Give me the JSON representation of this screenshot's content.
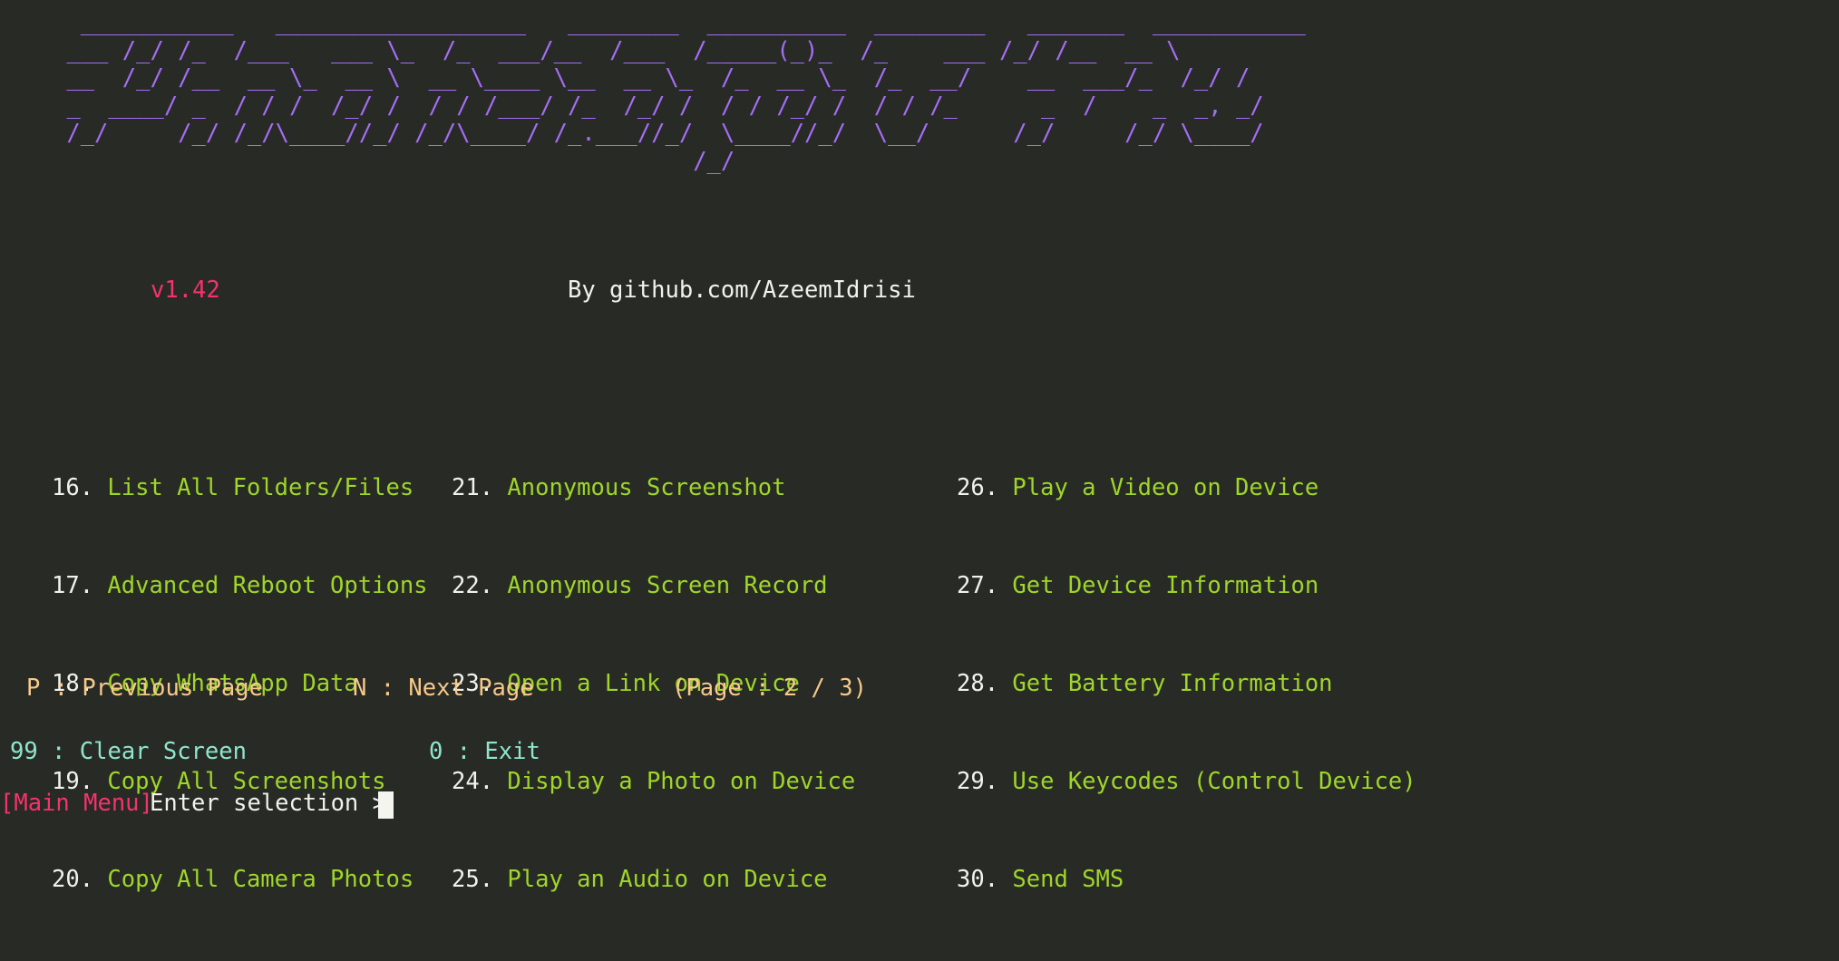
{
  "terminal": {
    "background_color": "#282a25",
    "banner_color": "#a46ef5",
    "menu_number_color": "#f2f2ec",
    "menu_label_color": "#9fd629",
    "nav_color": "#f7c98b",
    "util_color": "#8ee6cd",
    "accent_pink": "#f5336b",
    "banner_ascii": "  ___________   __________________   ________  __________  ________   _______  ___________\n ___ /_/ /_  /___   ___ \\_  /_  ___/__  /___  /_____(_)_  /_    ___ /_/ /__  __ \\\n __  /_/ /__  __ \\_  __ \\  __ \\____ \\__  __ \\_  /_  __ \\_  /_  __/    __  ___/_  /_/ /\n _  ____/ _  / / /  /_/ /  / / /___/ /_  /_/ /  / / /_/ /  / / /_      _  /    _  _, _/\n /_/     /_/ /_/\\____//_/ /_/\\____/ /_.___//_/  \\____//_/  \\__/      /_/     /_/ \\____/\n                                              /_/",
    "version": "v1.42",
    "author": "By github.com/AzeemIdrisi",
    "menu_columns": [
      [
        {
          "number": "16.",
          "label": "List All Folders/Files"
        },
        {
          "number": "17.",
          "label": "Advanced Reboot Options"
        },
        {
          "number": "18.",
          "label": "Copy WhatsApp Data"
        },
        {
          "number": "19.",
          "label": "Copy All Screenshots"
        },
        {
          "number": "20.",
          "label": "Copy All Camera Photos"
        }
      ],
      [
        {
          "number": "21.",
          "label": "Anonymous Screenshot"
        },
        {
          "number": "22.",
          "label": "Anonymous Screen Record"
        },
        {
          "number": "23.",
          "label": "Open a Link on Device"
        },
        {
          "number": "24.",
          "label": "Display a Photo on Device"
        },
        {
          "number": "25.",
          "label": "Play an Audio on Device"
        }
      ],
      [
        {
          "number": "26.",
          "label": "Play a Video on Device"
        },
        {
          "number": "27.",
          "label": "Get Device Information"
        },
        {
          "number": "28.",
          "label": "Get Battery Information"
        },
        {
          "number": "29.",
          "label": "Use Keycodes (Control Device)"
        },
        {
          "number": "30.",
          "label": "Send SMS"
        }
      ]
    ],
    "navigation": {
      "previous_page": "P : Previous Page",
      "next_page": "N : Next Page",
      "page_indicator": "(Page : 2 / 3)",
      "current_page": 2,
      "total_pages": 3
    },
    "utility": {
      "clear_screen": "99 : Clear Screen",
      "exit": "0 : Exit"
    },
    "prompt": {
      "tag": "[Main Menu]",
      "text": "Enter selection >",
      "input_value": ""
    }
  }
}
